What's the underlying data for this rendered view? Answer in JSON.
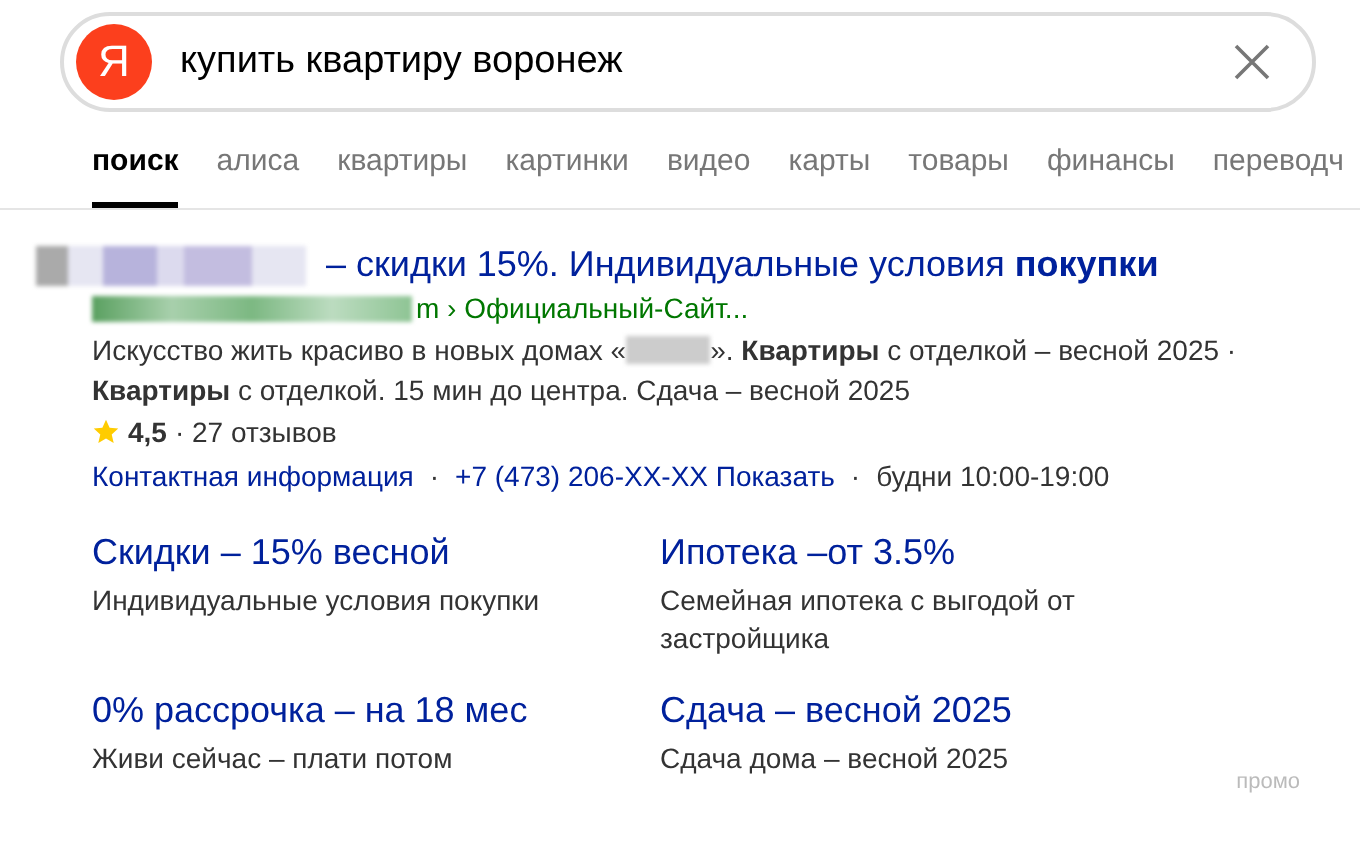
{
  "search": {
    "logo": "Я",
    "value": "купить квартиру воронеж"
  },
  "tabs": [
    {
      "label": "поиск",
      "selected": true
    },
    {
      "label": "алиса",
      "selected": false
    },
    {
      "label": "квартиры",
      "selected": false
    },
    {
      "label": "картинки",
      "selected": false
    },
    {
      "label": "видео",
      "selected": false
    },
    {
      "label": "карты",
      "selected": false
    },
    {
      "label": "товары",
      "selected": false
    },
    {
      "label": "финансы",
      "selected": false
    },
    {
      "label": "переводч",
      "selected": false
    }
  ],
  "ad": {
    "title": "– скидки 15%. Индивидуальные условия **покупки**",
    "url": "m › Официальный-Сайт...",
    "description_start": "Искусство жить красиво в новых домах «",
    "description_end": "». **Квартиры** с отделкой – весной 2025 · **Квартиры** с отделкой. 15 мин до центра. Сдача – весной 2025",
    "rating": "4,5",
    "separator": "·",
    "reviews": "· 27 отзывов",
    "contact": "Контактная информация",
    "phone": "+7 (473) 206-XX-XX Показать",
    "hours": "будни 10:00-19:00",
    "sitelinks": [
      {
        "title": "Скидки – 15% весной",
        "text": "Индивидуальные условия покупки"
      },
      {
        "title": "Ипотека –от 3.5%",
        "text": "Семейная ипотека с выгодой от застройщика"
      },
      {
        "title": "0% рассрочка – на 18 мес",
        "text": "Живи сейчас – плати потом"
      },
      {
        "title": "Сдача – весной 2025",
        "text": "Сдача дома – весной 2025"
      }
    ],
    "promo": "промо"
  }
}
